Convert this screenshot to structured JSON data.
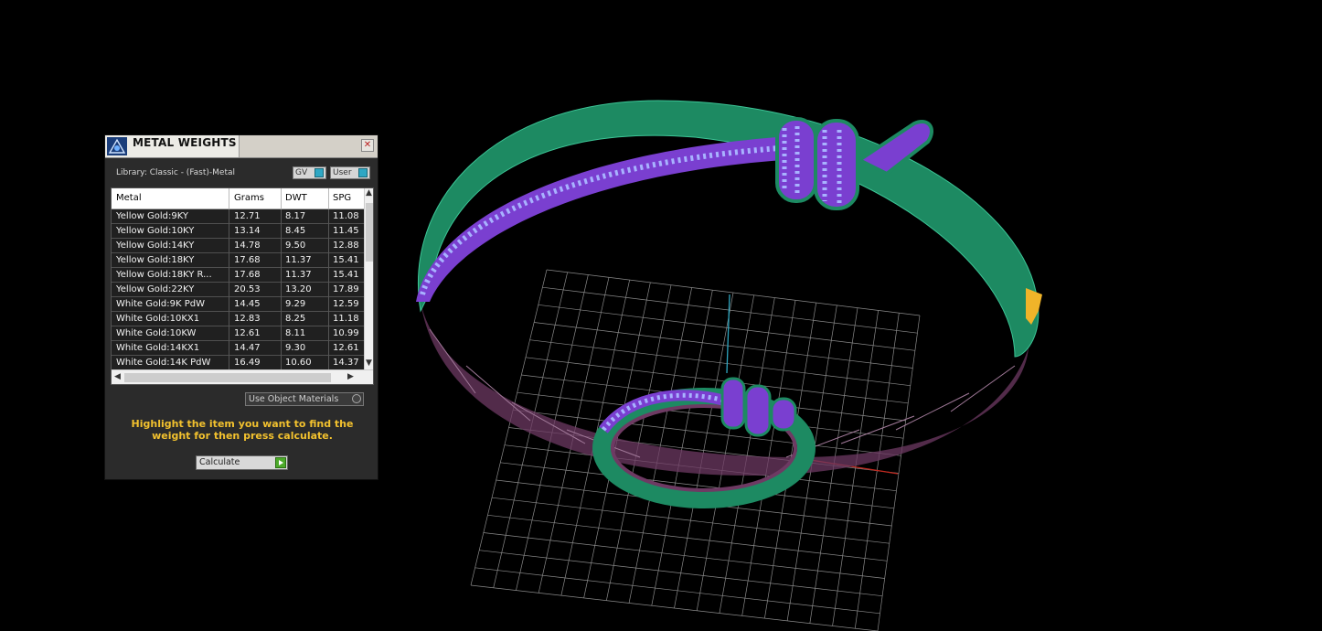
{
  "panel": {
    "title": "METAL WEIGHTS",
    "close_glyph": "✕",
    "library_label": "Library: Classic - (Fast)-Metal",
    "gv_label": "GV",
    "user_label": "User",
    "use_object_materials": "Use Object Materials",
    "instructions": "Highlight the item you want to find the weight for then press calculate.",
    "calculate_label": "Calculate"
  },
  "table": {
    "headers": [
      "Metal",
      "Grams",
      "DWT",
      "SPG"
    ],
    "rows": [
      [
        "Yellow Gold:9KY",
        "12.71",
        "8.17",
        "11.08"
      ],
      [
        "Yellow Gold:10KY",
        "13.14",
        "8.45",
        "11.45"
      ],
      [
        "Yellow Gold:14KY",
        "14.78",
        "9.50",
        "12.88"
      ],
      [
        "Yellow Gold:18KY",
        "17.68",
        "11.37",
        "15.41"
      ],
      [
        "Yellow Gold:18KY R...",
        "17.68",
        "11.37",
        "15.41"
      ],
      [
        "Yellow Gold:22KY",
        "20.53",
        "13.20",
        "17.89"
      ],
      [
        "White Gold:9K PdW",
        "14.45",
        "9.29",
        "12.59"
      ],
      [
        "White Gold:10KX1",
        "12.83",
        "8.25",
        "11.18"
      ],
      [
        "White Gold:10KW",
        "12.61",
        "8.11",
        "10.99"
      ],
      [
        "White Gold:14KX1",
        "14.47",
        "9.30",
        "12.61"
      ],
      [
        "White Gold:14K PdW",
        "16.49",
        "10.60",
        "14.37"
      ]
    ]
  },
  "icons": {
    "app": "app-logo-icon",
    "close": "close-icon",
    "scroll_up": "chevron-up-icon",
    "scroll_down": "chevron-down-icon",
    "scroll_left": "chevron-left-icon",
    "scroll_right": "chevron-right-icon",
    "calculate": "play-icon"
  },
  "colors": {
    "shank_green": "#1d8a62",
    "pave_purple": "#7a3fd0",
    "pave_stones": "#9aa6f4",
    "frame_purple": "#6e3a63",
    "instructions_yellow": "#f2c12e",
    "toggle_blue": "#2fa7c4"
  }
}
